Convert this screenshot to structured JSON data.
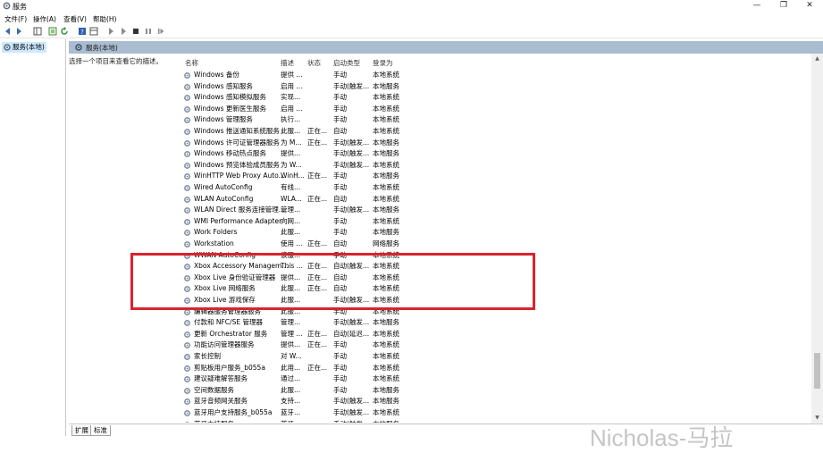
{
  "window": {
    "title": "服务",
    "minimize": "—",
    "maximize": "❐",
    "close": "✕"
  },
  "menu": [
    "文件(F)",
    "操作(A)",
    "查看(V)",
    "帮助(H)"
  ],
  "toolbar_icons": [
    "back-icon",
    "forward-icon",
    "console-tree-icon",
    "properties-icon",
    "refresh-icon",
    "export-icon",
    "help-icon",
    "show-hide-icon",
    "play-icon",
    "play-alt-icon",
    "stop-icon",
    "pause-icon",
    "restart-icon"
  ],
  "tree": {
    "root_label": "服务(本地)"
  },
  "pane": {
    "header": "服务(本地)",
    "description": "选择一个项目来查看它的描述。"
  },
  "columns": {
    "name": "名称",
    "desc": "描述",
    "status": "状态",
    "startup": "启动类型",
    "logon": "登录为"
  },
  "rows": [
    {
      "name": "Windows 备份",
      "desc": "提供 ...",
      "status": "",
      "startup": "手动",
      "logon": "本地系统"
    },
    {
      "name": "Windows 感知服务",
      "desc": "启用 ...",
      "status": "",
      "startup": "手动(触发...",
      "logon": "本地服务"
    },
    {
      "name": "Windows 感知模拟服务",
      "desc": "实现...",
      "status": "",
      "startup": "手动",
      "logon": "本地系统"
    },
    {
      "name": "Windows 更新医生服务",
      "desc": "启用 ...",
      "status": "",
      "startup": "手动",
      "logon": "本地系统"
    },
    {
      "name": "Windows 管理服务",
      "desc": "执行...",
      "status": "",
      "startup": "手动",
      "logon": "本地系统"
    },
    {
      "name": "Windows 推送通知系统服务",
      "desc": "此服...",
      "status": "正在...",
      "startup": "自动",
      "logon": "本地系统"
    },
    {
      "name": "Windows 许可证管理器服务",
      "desc": "为 M...",
      "status": "正在...",
      "startup": "手动(触发...",
      "logon": "本地服务"
    },
    {
      "name": "Windows 移动热点服务",
      "desc": "提供...",
      "status": "",
      "startup": "手动(触发...",
      "logon": "本地服务"
    },
    {
      "name": "Windows 预览体验成员服务",
      "desc": "为 W...",
      "status": "",
      "startup": "手动(触发...",
      "logon": "本地系统"
    },
    {
      "name": "WinHTTP Web Proxy Auto...",
      "desc": "WinH...",
      "status": "正在...",
      "startup": "手动",
      "logon": "本地服务"
    },
    {
      "name": "Wired AutoConfig",
      "desc": "有线...",
      "status": "",
      "startup": "手动",
      "logon": "本地系统"
    },
    {
      "name": "WLAN AutoConfig",
      "desc": "WLA...",
      "status": "正在...",
      "startup": "自动",
      "logon": "本地系统"
    },
    {
      "name": "WLAN Direct 服务连接管理...",
      "desc": "管理...",
      "status": "",
      "startup": "手动(触发...",
      "logon": "本地服务"
    },
    {
      "name": "WMI Performance Adapter",
      "desc": "向网...",
      "status": "",
      "startup": "手动",
      "logon": "本地系统"
    },
    {
      "name": "Work Folders",
      "desc": "此服...",
      "status": "",
      "startup": "手动",
      "logon": "本地服务"
    },
    {
      "name": "Workstation",
      "desc": "使用 ...",
      "status": "正在...",
      "startup": "自动",
      "logon": "网络服务"
    },
    {
      "name": "WWAN AutoConfig",
      "desc": "该服...",
      "status": "",
      "startup": "手动",
      "logon": "本地系统"
    },
    {
      "name": "Xbox Accessory Managem...",
      "desc": "This ...",
      "status": "正在...",
      "startup": "自动(触发...",
      "logon": "本地系统"
    },
    {
      "name": "Xbox Live 身份验证管理器",
      "desc": "提供...",
      "status": "正在...",
      "startup": "自动",
      "logon": "本地系统"
    },
    {
      "name": "Xbox Live 网络服务",
      "desc": "此服...",
      "status": "正在...",
      "startup": "自动",
      "logon": "本地系统"
    },
    {
      "name": "Xbox Live 游戏保存",
      "desc": "此服...",
      "status": "",
      "startup": "手动(触发...",
      "logon": "本地系统"
    },
    {
      "name": "编辑器服务管理器服务",
      "desc": "此服...",
      "status": "",
      "startup": "手动",
      "logon": "本地系统"
    },
    {
      "name": "付款和 NFC/SE 管理器",
      "desc": "管理...",
      "status": "",
      "startup": "手动(触发...",
      "logon": "本地服务"
    },
    {
      "name": "更新 Orchestrator 服务",
      "desc": "管理 ...",
      "status": "正在...",
      "startup": "自动(延迟...",
      "logon": "本地系统"
    },
    {
      "name": "功能访问管理器服务",
      "desc": "提供...",
      "status": "正在...",
      "startup": "手动",
      "logon": "本地系统"
    },
    {
      "name": "家长控制",
      "desc": "对 W...",
      "status": "",
      "startup": "手动",
      "logon": "本地系统"
    },
    {
      "name": "剪贴板用户服务_b055a",
      "desc": "此用...",
      "status": "正在...",
      "startup": "手动",
      "logon": "本地系统"
    },
    {
      "name": "建议疑难解答服务",
      "desc": "通过...",
      "status": "",
      "startup": "手动",
      "logon": "本地系统"
    },
    {
      "name": "空间数据服务",
      "desc": "此服...",
      "status": "",
      "startup": "手动",
      "logon": "本地服务"
    },
    {
      "name": "蓝牙音频网关服务",
      "desc": "支持...",
      "status": "",
      "startup": "手动(触发...",
      "logon": "本地服务"
    },
    {
      "name": "蓝牙用户支持服务_b055a",
      "desc": "蓝牙...",
      "status": "",
      "startup": "手动(触发...",
      "logon": "本地系统"
    },
    {
      "name": "蓝牙支持服务",
      "desc": "蓝牙...",
      "status": "",
      "startup": "手动(触发...",
      "logon": "本地服务"
    }
  ],
  "tabs": [
    "扩展",
    "标准"
  ],
  "watermark": "Nicholas-马拉",
  "colors": {
    "highlight": "#d9242f",
    "header": "#a9bcd0",
    "tree_selected": "#cde8ff"
  }
}
